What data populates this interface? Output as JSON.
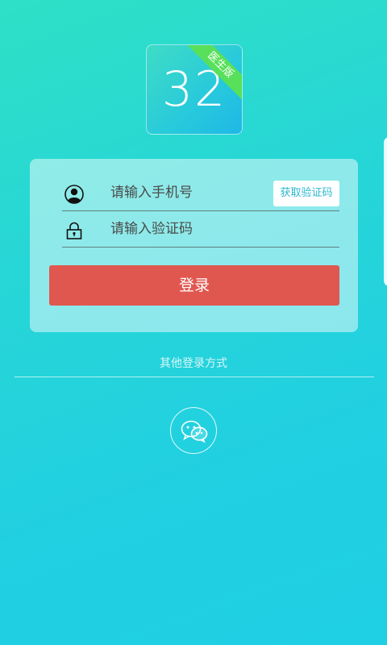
{
  "app": {
    "logo_number": "32",
    "logo_badge": "医生版"
  },
  "login_form": {
    "phone_placeholder": "请输入手机号",
    "code_placeholder": "请输入验证码",
    "get_code_label": "获取验证码",
    "login_label": "登录"
  },
  "other_login": {
    "label": "其他登录方式",
    "options": [
      "wechat-icon"
    ]
  },
  "colors": {
    "background_top": "#2ee0c6",
    "background_bottom": "#1fcfe4",
    "login_button": "#e0574f",
    "get_code_text": "#2bb8cf",
    "badge": "#58e05a"
  }
}
